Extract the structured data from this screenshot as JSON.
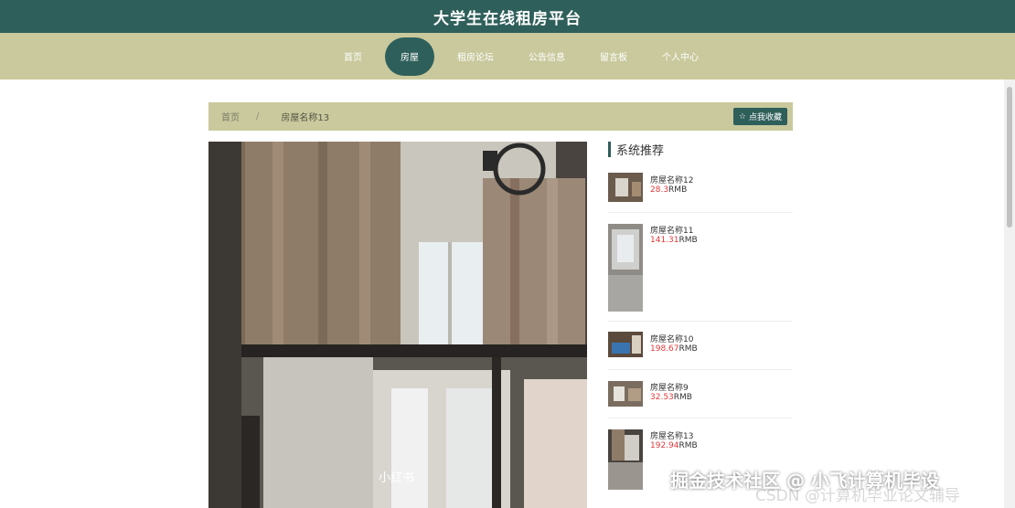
{
  "header": {
    "title": "大学生在线租房平台"
  },
  "nav": {
    "items": [
      {
        "label": "首页",
        "active": false
      },
      {
        "label": "房屋",
        "active": true
      },
      {
        "label": "租房论坛",
        "active": false
      },
      {
        "label": "公告信息",
        "active": false
      },
      {
        "label": "留言板",
        "active": false
      },
      {
        "label": "个人中心",
        "active": false
      }
    ]
  },
  "breadcrumb": {
    "home": "首页",
    "separator": "/",
    "current": "房屋名称13",
    "favorite_label": "点我收藏"
  },
  "sidebar": {
    "title": "系统推荐",
    "items": [
      {
        "name": "房屋名称12",
        "price": "28.3",
        "unit": "RMB"
      },
      {
        "name": "房屋名称11",
        "price": "141.31",
        "unit": "RMB"
      },
      {
        "name": "房屋名称10",
        "price": "198.67",
        "unit": "RMB"
      },
      {
        "name": "房屋名称9",
        "price": "32.53",
        "unit": "RMB"
      },
      {
        "name": "房屋名称13",
        "price": "192.94",
        "unit": "RMB"
      }
    ]
  },
  "watermark": {
    "line1": "掘金技术社区 @ 小飞计算机毕设",
    "line2": "CSDN @计算机毕业论文辅导"
  },
  "colors": {
    "primary": "#2f5f5a",
    "nav_bg": "#c9c99d",
    "price": "#e4393c"
  }
}
